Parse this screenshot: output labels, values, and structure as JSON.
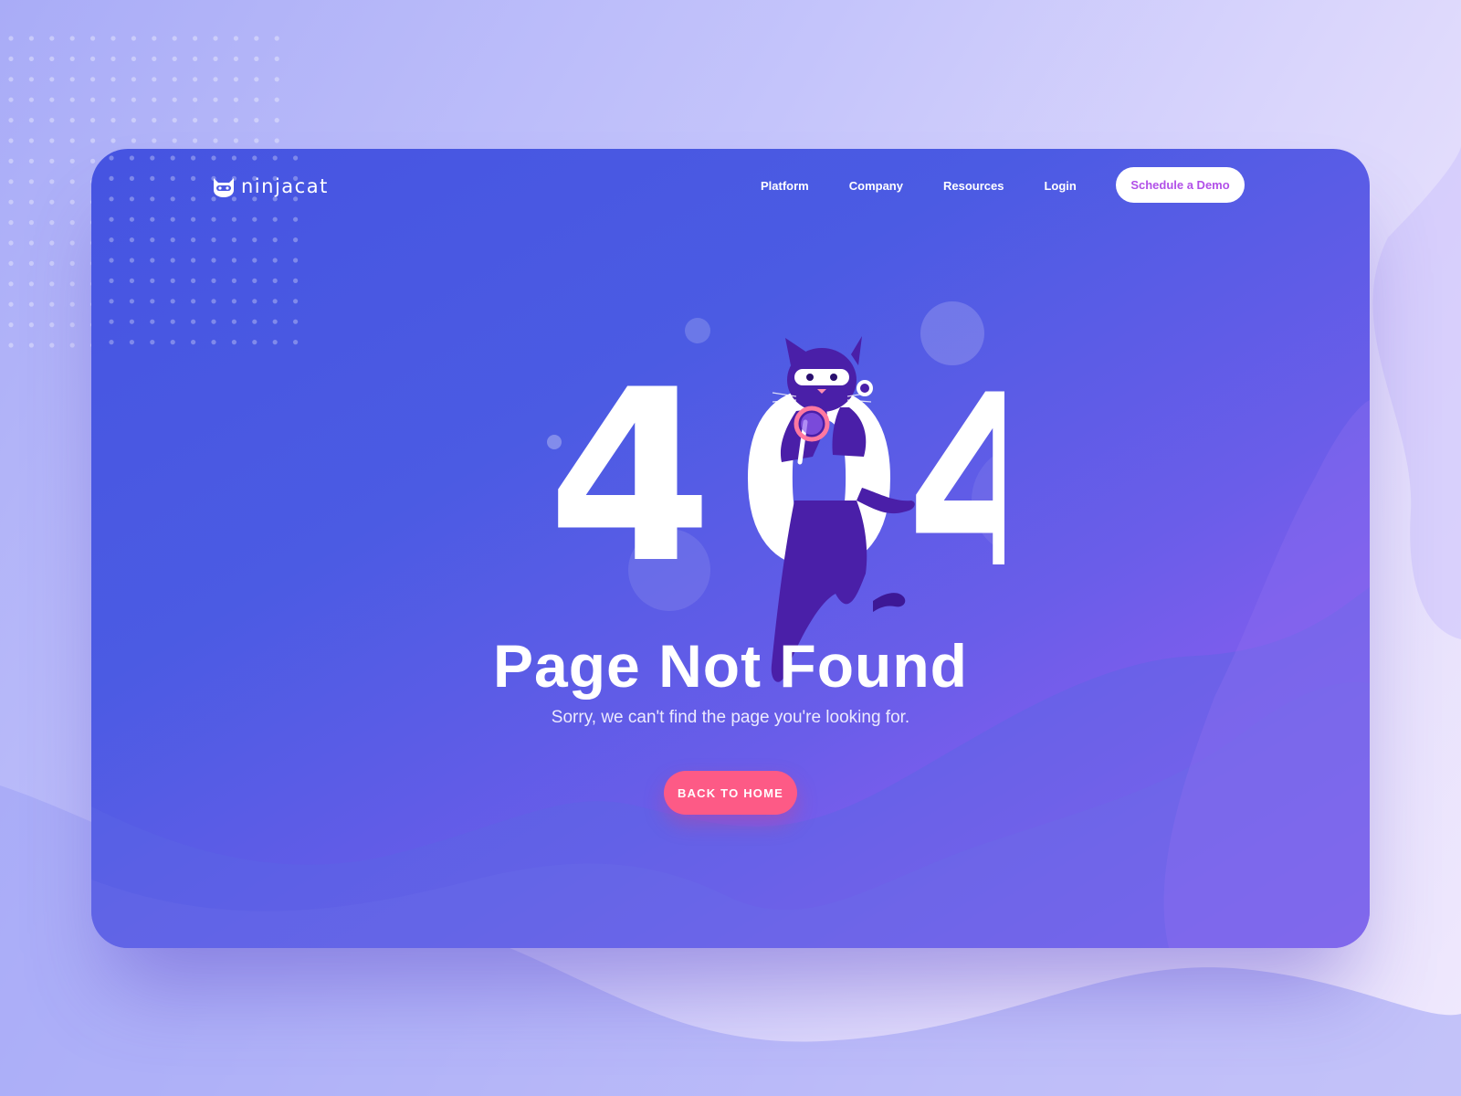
{
  "brand": {
    "name": "ninjacat"
  },
  "nav": {
    "items": [
      {
        "label": "Platform"
      },
      {
        "label": "Company"
      },
      {
        "label": "Resources"
      },
      {
        "label": "Login"
      }
    ],
    "cta_label": "Schedule a Demo"
  },
  "hero": {
    "error_code": "404",
    "title": "Page Not Found",
    "subtitle": "Sorry, we can't find the page you're looking for.",
    "button_label": "BACK TO HOME"
  },
  "colors": {
    "accent_pink": "#fd5a86",
    "cta_text": "#b150e8",
    "card_start": "#4654e1",
    "card_end": "#a15df3",
    "cat_purple": "#4a1fa8"
  }
}
